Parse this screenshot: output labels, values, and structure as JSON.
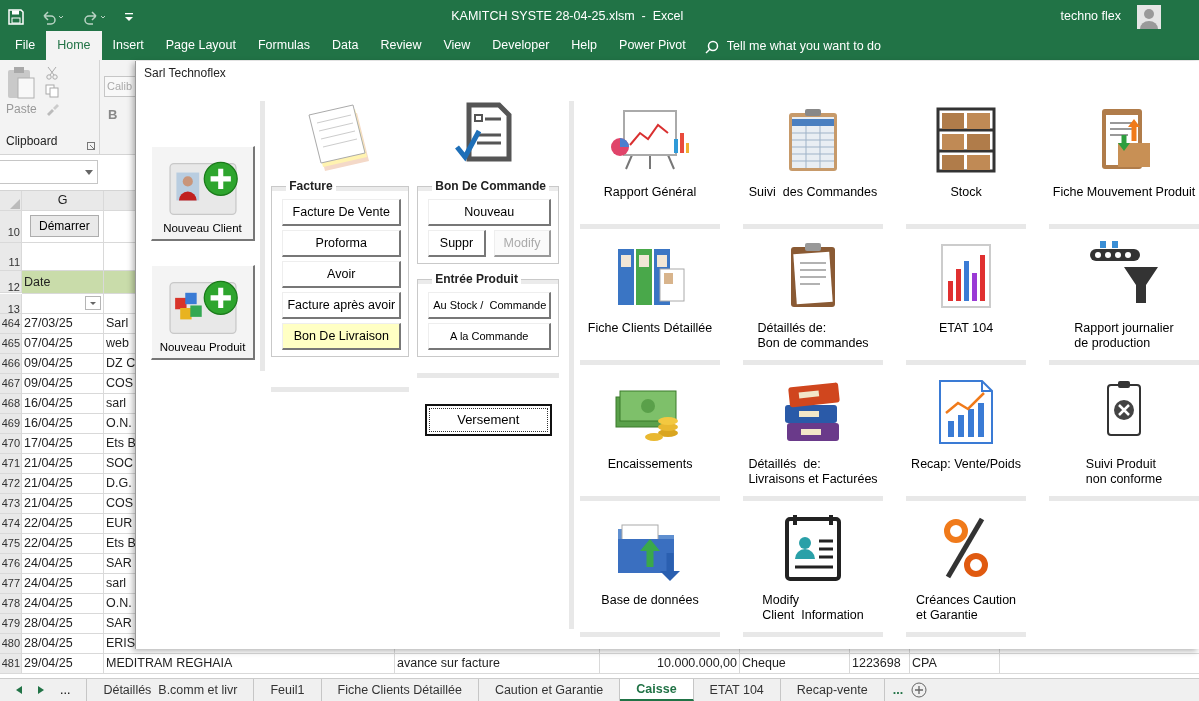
{
  "title_bar": {
    "title": "KAMITCH SYSTE 28-04-25.xlsm  -  Excel",
    "user": "techno flex"
  },
  "ribbon_tabs": [
    {
      "label": "File",
      "selected": false
    },
    {
      "label": "Home",
      "selected": true
    },
    {
      "label": "Insert",
      "selected": false
    },
    {
      "label": "Page Layout",
      "selected": false
    },
    {
      "label": "Formulas",
      "selected": false
    },
    {
      "label": "Data",
      "selected": false
    },
    {
      "label": "Review",
      "selected": false
    },
    {
      "label": "View",
      "selected": false
    },
    {
      "label": "Developer",
      "selected": false
    },
    {
      "label": "Help",
      "selected": false
    },
    {
      "label": "Power Pivot",
      "selected": false
    }
  ],
  "tell_me": {
    "placeholder": "Tell me what you want to do"
  },
  "ribbon": {
    "paste_label": "Paste",
    "group_label": "Clipboard",
    "font_box": "Calib",
    "bold_key": "B"
  },
  "sheet": {
    "column_label": "G",
    "start_button": "Démarrer",
    "row_labels": [
      "10",
      "11",
      "12",
      "13"
    ],
    "date_heading": "Date",
    "rows": [
      {
        "number": "464",
        "date": "27/03/25",
        "client": "Sarl"
      },
      {
        "number": "465",
        "date": "07/04/25",
        "client": "web"
      },
      {
        "number": "466",
        "date": "09/04/25",
        "client": "DZ C"
      },
      {
        "number": "467",
        "date": "09/04/25",
        "client": "COS"
      },
      {
        "number": "468",
        "date": "16/04/25",
        "client": "sarl"
      },
      {
        "number": "469",
        "date": "16/04/25",
        "client": "O.N."
      },
      {
        "number": "470",
        "date": "17/04/25",
        "client": "Ets B"
      },
      {
        "number": "471",
        "date": "21/04/25",
        "client": "SOC"
      },
      {
        "number": "472",
        "date": "21/04/25",
        "client": "D.G."
      },
      {
        "number": "473",
        "date": "21/04/25",
        "client": "COS"
      },
      {
        "number": "474",
        "date": "22/04/25",
        "client": "EUR"
      },
      {
        "number": "475",
        "date": "22/04/25",
        "client": "Ets B"
      },
      {
        "number": "476",
        "date": "24/04/25",
        "client": "SAR"
      },
      {
        "number": "477",
        "date": "24/04/25",
        "client": "sarl"
      },
      {
        "number": "478",
        "date": "24/04/25",
        "client": "O.N."
      },
      {
        "number": "479",
        "date": "28/04/25",
        "client": "SAR"
      },
      {
        "number": "480",
        "date": "28/04/25",
        "client": "ERIS"
      }
    ],
    "last_row": {
      "number": "481",
      "cells": [
        "29/04/25",
        "MEDITRAM REGHAIA",
        "avance sur facture",
        "10.000.000,00",
        "Cheque",
        "1223698",
        "CPA"
      ]
    }
  },
  "sheet_tabs": [
    {
      "label": "Détaillés  B.comm et livr",
      "selected": false
    },
    {
      "label": "Feuil1",
      "selected": false
    },
    {
      "label": "Fiche Clients Détaillée",
      "selected": false
    },
    {
      "label": "Caution et Garantie",
      "selected": false
    },
    {
      "label": "Caisse",
      "selected": true
    },
    {
      "label": "ETAT 104",
      "selected": false
    },
    {
      "label": "Recap-vente",
      "selected": false
    }
  ],
  "sheet_tabs_more": "...",
  "sheet_tabs_more_left": "...",
  "dialog": {
    "title": "Sarl Technoflex",
    "quick_buttons": [
      {
        "label": "Nouveau Client"
      },
      {
        "label": "Nouveau Produit"
      }
    ],
    "groups": [
      {
        "title": "Facture",
        "rows": [
          [
            {
              "label": "Facture De Vente",
              "highlighted": false,
              "disabled": false
            }
          ],
          [
            {
              "label": "Proforma",
              "highlighted": false,
              "disabled": false
            }
          ],
          [
            {
              "label": "Avoir",
              "highlighted": false,
              "disabled": false
            }
          ],
          [
            {
              "label": "Facture après avoir",
              "highlighted": false,
              "disabled": false
            }
          ],
          [
            {
              "label": "Bon De Livraison",
              "highlighted": true,
              "disabled": false
            }
          ]
        ]
      },
      {
        "title": "Bon De Commande",
        "rows": [
          [
            {
              "label": "Nouveau",
              "highlighted": false,
              "disabled": false
            }
          ],
          [
            {
              "label": "Suppr",
              "highlighted": false,
              "disabled": false
            },
            {
              "label": "Modify",
              "highlighted": false,
              "disabled": true
            }
          ]
        ]
      },
      {
        "title": "Entrée Produit",
        "rows": [
          [
            {
              "label": "Au Stock /  Commande",
              "highlighted": false,
              "disabled": false
            }
          ],
          [
            {
              "label": "A la Commande",
              "highlighted": false,
              "disabled": false
            }
          ]
        ]
      }
    ],
    "versement": {
      "label": "Versement",
      "focused": true
    },
    "tiles": [
      {
        "lines": [
          "Rapport Général"
        ]
      },
      {
        "lines": [
          "Suivi  des Commandes"
        ]
      },
      {
        "lines": [
          "Stock"
        ]
      },
      {
        "lines": [
          "Fiche Mouvement Produit"
        ]
      },
      {
        "lines": [
          "Fiche Clients Détaillée"
        ]
      },
      {
        "lines": [
          "Détaillés de:",
          "Bon de commandes"
        ]
      },
      {
        "lines": [
          "ETAT 104"
        ]
      },
      {
        "lines": [
          "Rapport journalier",
          "de production"
        ]
      },
      {
        "lines": [
          "Encaissements"
        ]
      },
      {
        "lines": [
          "Détaillés  de:",
          "Livraisons et Facturées"
        ]
      },
      {
        "lines": [
          "Recap: Vente/Poids"
        ]
      },
      {
        "lines": [
          "Suivi Produit",
          "non conforme"
        ]
      },
      {
        "lines": [
          "Base de données"
        ]
      },
      {
        "lines": [
          "Modify",
          "Client  Information"
        ]
      },
      {
        "lines": [
          "Créances Caution",
          "et Garantie"
        ]
      }
    ]
  }
}
